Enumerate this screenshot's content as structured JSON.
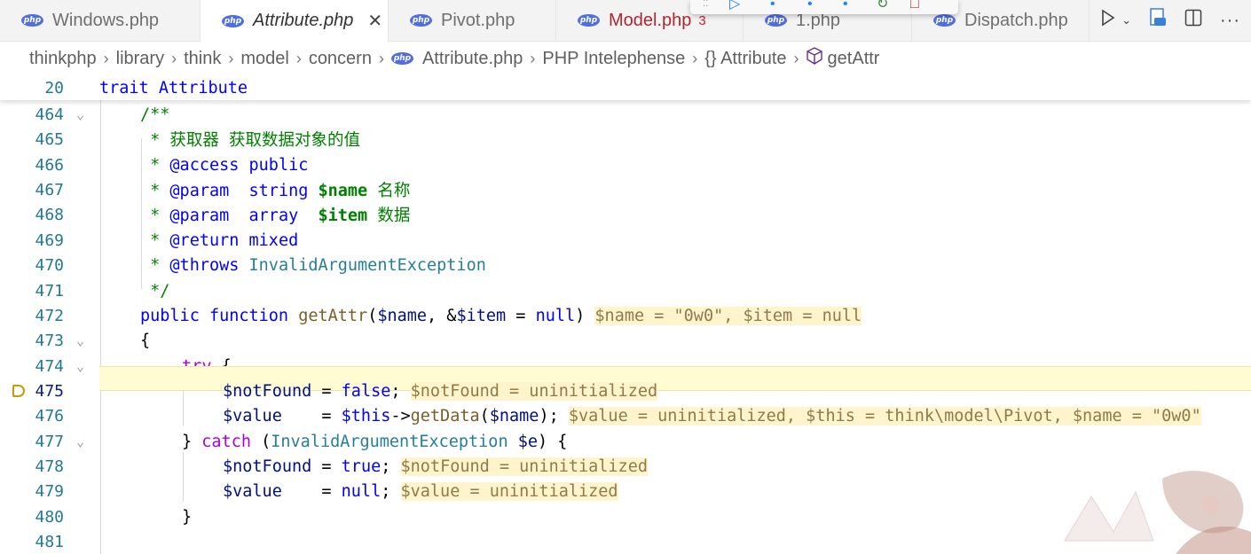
{
  "tabs": [
    {
      "label": "Windows.php"
    },
    {
      "label": "Attribute.php",
      "close": "✕"
    },
    {
      "label": "Pivot.php"
    },
    {
      "label": "Model.php",
      "count": "3"
    },
    {
      "label": "1.php"
    },
    {
      "label": "Dispatch.php"
    }
  ],
  "php_badge": "php",
  "breadcrumb": [
    "thinkphp",
    "library",
    "think",
    "model",
    "concern",
    "Attribute.php",
    "PHP Intelephense",
    "{} Attribute",
    "getAttr"
  ],
  "sticky": {
    "num": "20",
    "code": "trait Attribute"
  },
  "lines": [
    {
      "num": "464"
    },
    {
      "num": "465"
    },
    {
      "num": "466"
    },
    {
      "num": "467"
    },
    {
      "num": "468"
    },
    {
      "num": "469"
    },
    {
      "num": "470"
    },
    {
      "num": "471"
    },
    {
      "num": "472"
    },
    {
      "num": "473"
    },
    {
      "num": "474"
    },
    {
      "num": "475"
    },
    {
      "num": "476"
    },
    {
      "num": "477"
    },
    {
      "num": "478"
    },
    {
      "num": "479"
    },
    {
      "num": "480"
    },
    {
      "num": "481"
    }
  ],
  "code": {
    "l464": "/**",
    "l465": " * 获取器 获取数据对象的值",
    "l466_a": " * ",
    "l466_b": "@access",
    "l466_c": " public",
    "l467_a": " * ",
    "l467_b": "@param",
    "l467_c": "  string ",
    "l467_d": "$name",
    "l467_e": " 名称",
    "l468_a": " * ",
    "l468_b": "@param",
    "l468_c": "  array  ",
    "l468_d": "$item",
    "l468_e": " 数据",
    "l469_a": " * ",
    "l469_b": "@return",
    "l469_c": " mixed",
    "l470_a": " * ",
    "l470_b": "@throws",
    "l470_c": " InvalidArgumentException",
    "l471": " */",
    "l472_kw1": "public",
    "l472_kw2": "function",
    "l472_fn": "getAttr",
    "l472_p1": "(",
    "l472_v1": "$name",
    "l472_p2": ", &",
    "l472_v2": "$item",
    "l472_p3": " = ",
    "l472_null": "null",
    "l472_p4": ")",
    "l472_inl": "$name = \"0w0\", $item = null",
    "l473": "{",
    "l474_kw": "try",
    "l474_p": " {",
    "l475_v": "$notFound",
    "l475_p": " = ",
    "l475_k": "false",
    "l475_s": ";",
    "l475_inl": "$notFound = uninitialized",
    "l476_v": "$value",
    "l476_p": "    = ",
    "l476_this": "$this",
    "l476_arrow": "->",
    "l476_fn": "getData",
    "l476_p2": "(",
    "l476_v2": "$name",
    "l476_p3": ");",
    "l476_inl": "$value = uninitialized, $this = think\\model\\Pivot, $name = \"0w0\"",
    "l477_p1": "} ",
    "l477_kw": "catch",
    "l477_p2": " (",
    "l477_ty": "InvalidArgumentException",
    "l477_sp": " ",
    "l477_v": "$e",
    "l477_p3": ") {",
    "l478_v": "$notFound",
    "l478_p": " = ",
    "l478_k": "true",
    "l478_s": ";",
    "l478_inl": "$notFound = uninitialized",
    "l479_v": "$value",
    "l479_p": "    = ",
    "l479_k": "null",
    "l479_s": ";",
    "l479_inl": "$value = uninitialized",
    "l480": "}"
  },
  "colors": {
    "accent": "#007acc",
    "breakpoint": "#c89a0a",
    "highlight": "#fffbd3"
  }
}
